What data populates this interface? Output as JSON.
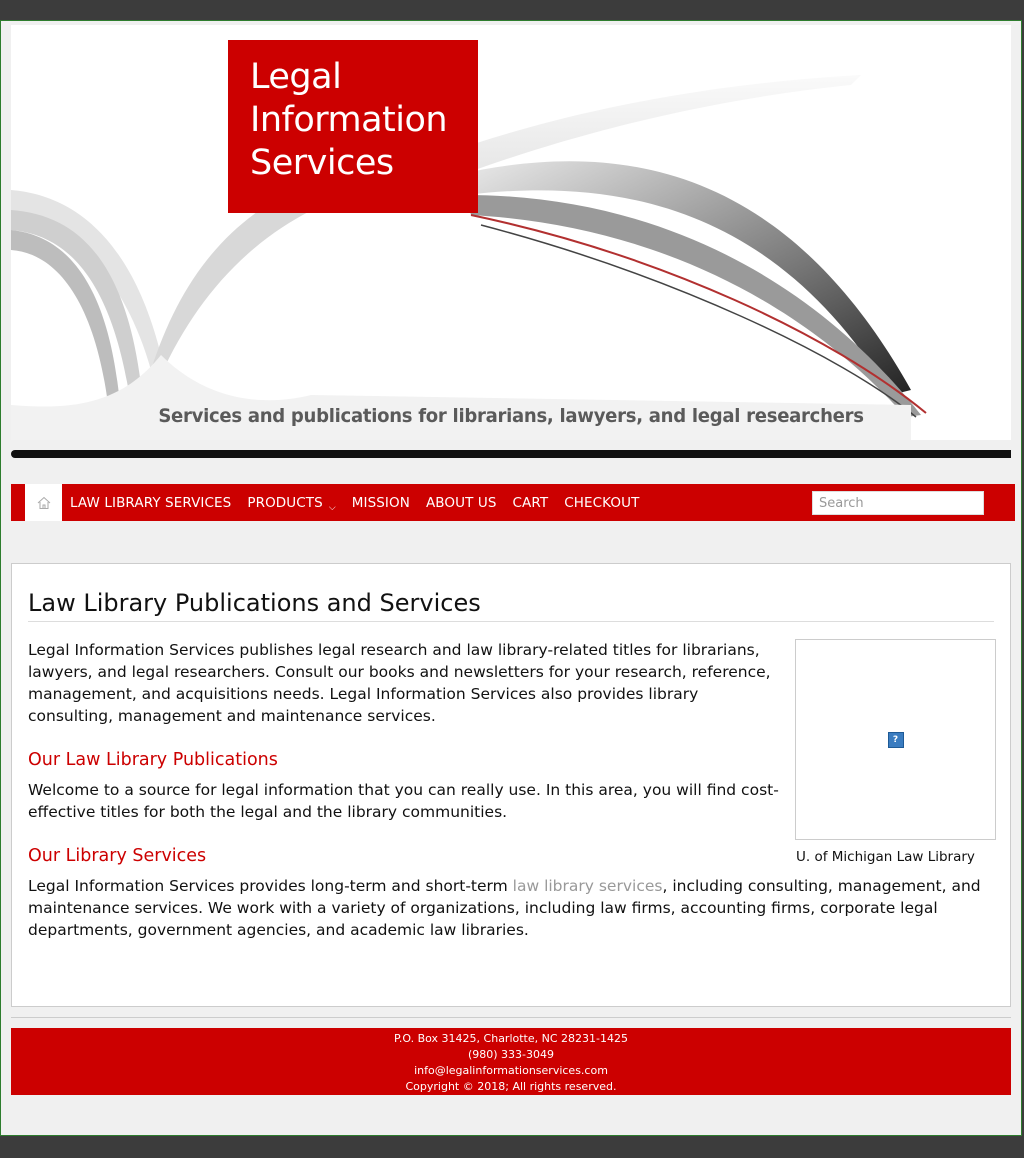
{
  "banner": {
    "logo_lines": [
      "Legal",
      "Information",
      "Services"
    ],
    "tagline": "Services and publications for librarians, lawyers, and legal researchers"
  },
  "nav": {
    "home_icon": "home-icon",
    "items": [
      {
        "label": "LAW LIBRARY SERVICES"
      },
      {
        "label": "PRODUCTS",
        "has_dropdown": true
      },
      {
        "label": "MISSION"
      },
      {
        "label": "ABOUT US"
      },
      {
        "label": "CART"
      },
      {
        "label": "CHECKOUT"
      }
    ],
    "search_placeholder": "Search"
  },
  "main": {
    "title": "Law Library Publications and Services",
    "intro": "Legal Information Services publishes legal research and law library-related titles for librarians, lawyers, and legal researchers. Consult our books and newsletters for your research, reference, management, and acquisitions needs. Legal Information Services also provides library consulting, management and maintenance services.",
    "publications_heading": "Our Law Library Publications",
    "publications_text": "Welcome to a source for legal information that you can really use. In this area, you will find cost-effective titles for both the legal and the library communities.",
    "services_heading": "Our Library Services",
    "services_text_before": "Legal Information Services provides long-term and short-term ",
    "services_link": "law library services",
    "services_text_after": ", including consulting, management, and maintenance services. We work with a variety of organizations, including law firms, accounting firms, corporate legal departments, government agencies, and academic law libraries.",
    "image_caption": "U. of Michigan Law Library"
  },
  "footer": {
    "lines": [
      "P.O. Box 31425, Charlotte, NC 28231-1425",
      "(980) 333-3049",
      "info@legalinformationservices.com",
      "Copyright © 2018; All rights reserved."
    ]
  },
  "colors": {
    "brand_red": "#cc0000",
    "page_background": "#3c3c3c",
    "link_gray": "#999999"
  }
}
